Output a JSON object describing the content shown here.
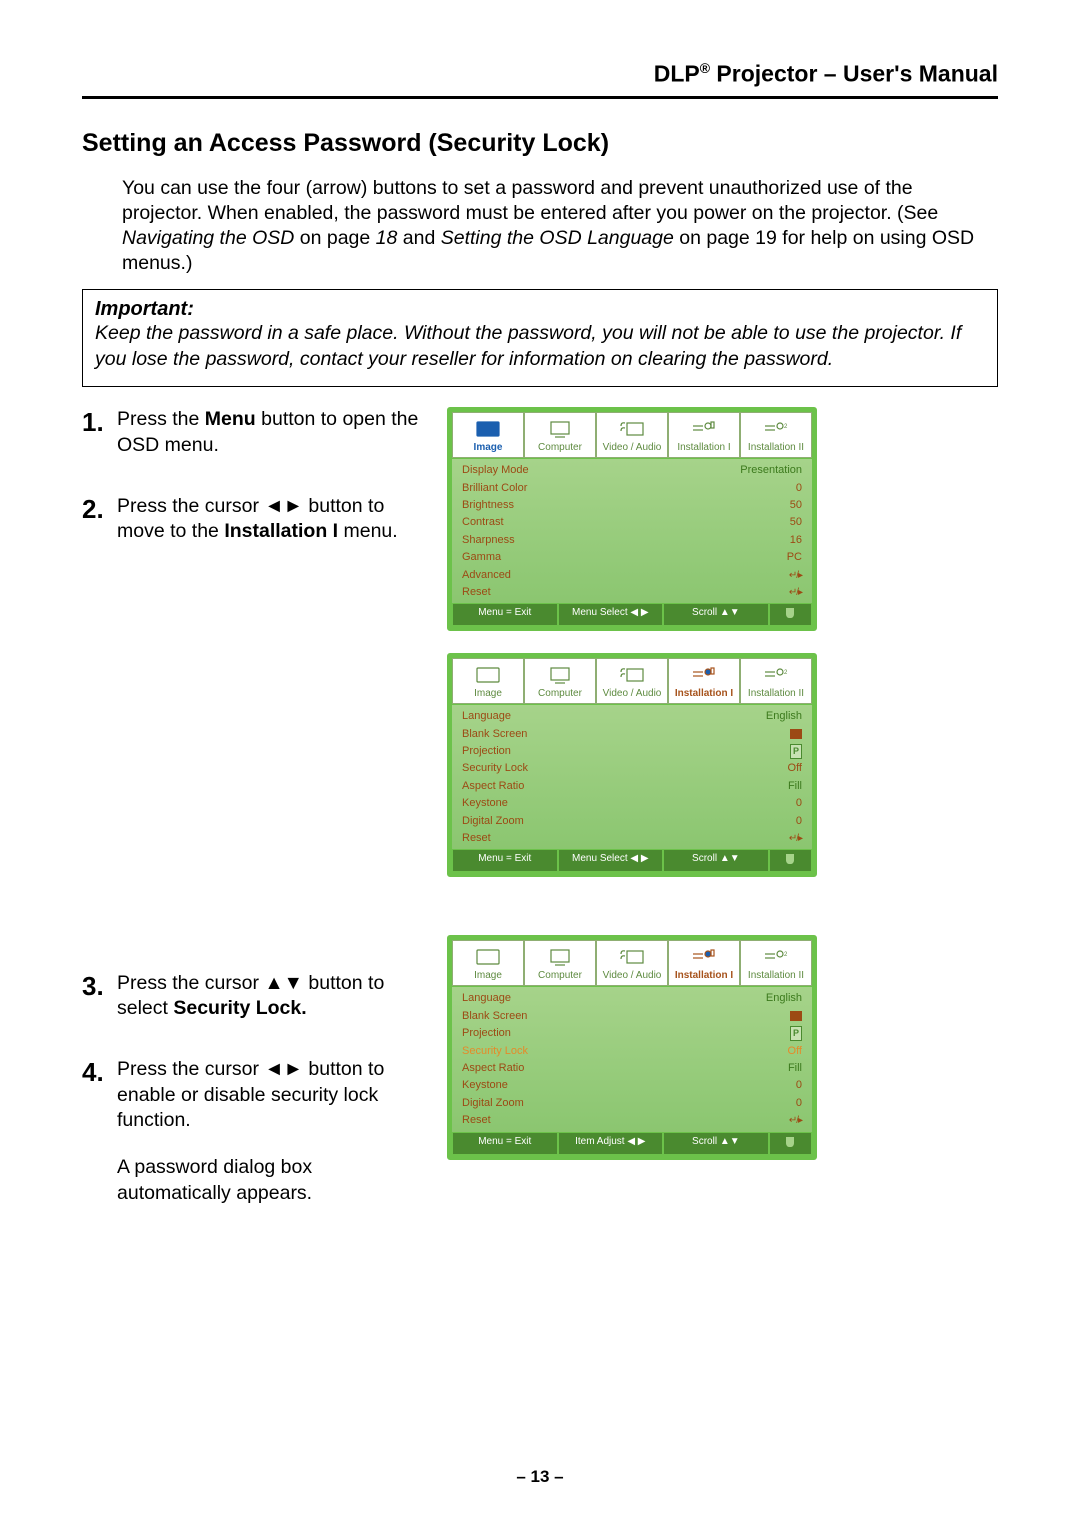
{
  "header": {
    "title_prefix": "DLP",
    "title_sup": "®",
    "title_rest": " Projector – User's Manual"
  },
  "section_title": "Setting an Access Password (Security Lock)",
  "intro": {
    "part1": "You can use the four (arrow) buttons to set a password and prevent unauthorized use of the projector. When enabled, the password must be entered after you power on the projector. (See ",
    "italic1": "Navigating the OSD",
    "part2": " on page ",
    "italic2": "18",
    "part3": " and ",
    "italic3": "Setting the OSD Language",
    "part4": " on page 19 for help on using OSD menus.)"
  },
  "important": {
    "label": "Important:",
    "text": "Keep the password in a safe place. Without the password, you will not be able to use the projector. If you lose the password, contact your reseller for information on clearing the password."
  },
  "steps": {
    "s1_a": "Press the ",
    "s1_b": "Menu",
    "s1_c": " button to open the OSD menu.",
    "s2_a": "Press the cursor ◄► button to move to the ",
    "s2_b": "Installation I",
    "s2_c": " menu.",
    "s3_a": "Press the cursor ▲▼ button to select ",
    "s3_b": "Security Lock",
    "s4": "Press the cursor ◄► button to enable or disable security lock function.",
    "s4_extra": "A password dialog box automatically appears."
  },
  "osd_tabs": {
    "t1": "Image",
    "t2": "Computer",
    "t3": "Video / Audio",
    "t4": "Installation I",
    "t5": "Installation II"
  },
  "osd1": {
    "rows": [
      {
        "label": "Display Mode",
        "value": "Presentation"
      },
      {
        "label": "Brilliant Color",
        "value": "0"
      },
      {
        "label": "Brightness",
        "value": "50"
      },
      {
        "label": "Contrast",
        "value": "50"
      },
      {
        "label": "Sharpness",
        "value": "16"
      },
      {
        "label": "Gamma",
        "value": "PC"
      },
      {
        "label": "Advanced",
        "value": "↵/▸"
      },
      {
        "label": "Reset",
        "value": "↵/▸"
      }
    ],
    "footer": {
      "f1": "Menu = Exit",
      "f2": "Menu Select ◀ ▶",
      "f3": "Scroll ▲▼"
    }
  },
  "osd2": {
    "rows": [
      {
        "label": "Language",
        "value": "English"
      },
      {
        "label": "Blank Screen",
        "value": "[square]"
      },
      {
        "label": "Projection",
        "value": "[P]"
      },
      {
        "label": "Security Lock",
        "value": "Off"
      },
      {
        "label": "Aspect Ratio",
        "value": "Fill"
      },
      {
        "label": "Keystone",
        "value": "0"
      },
      {
        "label": "Digital Zoom",
        "value": "0"
      },
      {
        "label": "Reset",
        "value": "↵/▸"
      }
    ],
    "footer": {
      "f1": "Menu = Exit",
      "f2": "Menu Select ◀ ▶",
      "f3": "Scroll ▲▼"
    }
  },
  "osd3": {
    "rows": [
      {
        "label": "Language",
        "value": "English"
      },
      {
        "label": "Blank Screen",
        "value": "[square]"
      },
      {
        "label": "Projection",
        "value": "[P]"
      },
      {
        "label": "Security Lock",
        "value": "Off",
        "selected": true
      },
      {
        "label": "Aspect Ratio",
        "value": "Fill"
      },
      {
        "label": "Keystone",
        "value": "0"
      },
      {
        "label": "Digital Zoom",
        "value": "0"
      },
      {
        "label": "Reset",
        "value": "↵/▸"
      }
    ],
    "footer": {
      "f1": "Menu = Exit",
      "f2": "Item Adjust ◀ ▶",
      "f3": "Scroll ▲▼"
    }
  },
  "page_number": "– 13 –"
}
